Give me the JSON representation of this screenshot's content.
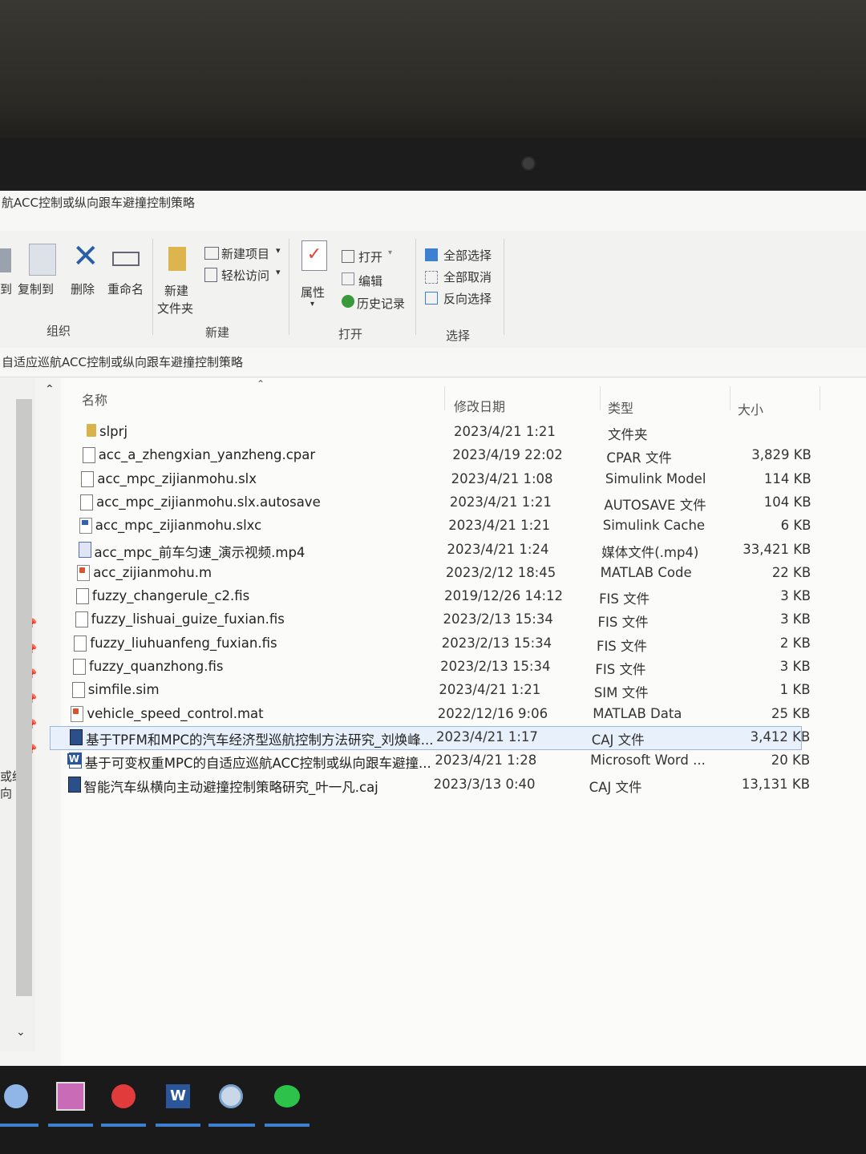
{
  "window": {
    "title": "航ACC控制或纵向跟车避撞控制策略"
  },
  "ribbon": {
    "organize": {
      "copy_to_label": "到",
      "copy_label": "复制到",
      "delete_label": "删除",
      "rename_label": "重命名",
      "group_label": "组织"
    },
    "new": {
      "new_folder_label_1": "新建",
      "new_folder_label_2": "文件夹",
      "new_item_label": "新建项目",
      "easy_access_label": "轻松访问",
      "group_label": "新建"
    },
    "open": {
      "properties_label": "属性",
      "open_label": "打开",
      "edit_label": "编辑",
      "history_label": "历史记录",
      "group_label": "打开"
    },
    "select": {
      "select_all_label": "全部选择",
      "select_none_label": "全部取消",
      "invert_label": "反向选择",
      "group_label": "选择"
    }
  },
  "address": {
    "path": "自适应巡航ACC控制或纵向跟车避撞控制策略"
  },
  "nav": {
    "partial_label": "或纵向"
  },
  "columns": {
    "name": "名称",
    "date": "修改日期",
    "type": "类型",
    "size": "大小"
  },
  "files": [
    {
      "name": "slprj",
      "date": "2023/4/21 1:21",
      "type": "文件夹",
      "size": "",
      "icon": "folder-icon"
    },
    {
      "name": "acc_a_zhengxian_yanzheng.cpar",
      "date": "2023/4/19 22:02",
      "type": "CPAR 文件",
      "size": "3,829 KB",
      "icon": "file-icon"
    },
    {
      "name": "acc_mpc_zijianmohu.slx",
      "date": "2023/4/21 1:08",
      "type": "Simulink Model",
      "size": "114 KB",
      "icon": "file-icon"
    },
    {
      "name": "acc_mpc_zijianmohu.slx.autosave",
      "date": "2023/4/21 1:21",
      "type": "AUTOSAVE 文件",
      "size": "104 KB",
      "icon": "file-icon"
    },
    {
      "name": "acc_mpc_zijianmohu.slxc",
      "date": "2023/4/21 1:21",
      "type": "Simulink Cache",
      "size": "6 KB",
      "icon": "simulink-icon"
    },
    {
      "name": "acc_mpc_前车匀速_演示视频.mp4",
      "date": "2023/4/21 1:24",
      "type": "媒体文件(.mp4)",
      "size": "33,421 KB",
      "icon": "video-icon"
    },
    {
      "name": "acc_zijianmohu.m",
      "date": "2023/2/12 18:45",
      "type": "MATLAB Code",
      "size": "22 KB",
      "icon": "matlab-icon"
    },
    {
      "name": "fuzzy_changerule_c2.fis",
      "date": "2019/12/26 14:12",
      "type": "FIS 文件",
      "size": "3 KB",
      "icon": "file-icon"
    },
    {
      "name": "fuzzy_lishuai_guize_fuxian.fis",
      "date": "2023/2/13 15:34",
      "type": "FIS 文件",
      "size": "3 KB",
      "icon": "file-icon"
    },
    {
      "name": "fuzzy_liuhuanfeng_fuxian.fis",
      "date": "2023/2/13 15:34",
      "type": "FIS 文件",
      "size": "2 KB",
      "icon": "file-icon"
    },
    {
      "name": "fuzzy_quanzhong.fis",
      "date": "2023/2/13 15:34",
      "type": "FIS 文件",
      "size": "3 KB",
      "icon": "file-icon"
    },
    {
      "name": "simfile.sim",
      "date": "2023/4/21 1:21",
      "type": "SIM 文件",
      "size": "1 KB",
      "icon": "file-icon"
    },
    {
      "name": "vehicle_speed_control.mat",
      "date": "2022/12/16 9:06",
      "type": "MATLAB Data",
      "size": "25 KB",
      "icon": "matlab-icon"
    },
    {
      "name": "基于TPFM和MPC的汽车经济型巡航控制方法研究_刘焕峰...",
      "date": "2023/4/21 1:17",
      "type": "CAJ 文件",
      "size": "3,412 KB",
      "icon": "caj-icon"
    },
    {
      "name": "基于可变权重MPC的自适应巡航ACC控制或纵向跟车避撞...",
      "date": "2023/4/21 1:28",
      "type": "Microsoft Word ...",
      "size": "20 KB",
      "icon": "word-icon"
    },
    {
      "name": "智能汽车纵横向主动避撞控制策略研究_叶一凡.caj",
      "date": "2023/3/13 0:40",
      "type": "CAJ 文件",
      "size": "13,131 KB",
      "icon": "caj-icon"
    }
  ],
  "taskbar": {
    "apps": [
      "app-icon",
      "paint-icon",
      "car-app-icon",
      "word-icon",
      "settings-icon",
      "wechat-icon"
    ]
  },
  "colors": {
    "selection": "#e8f1fb",
    "selection_border": "#9ab8dc",
    "taskbar": "#1a1a1a",
    "accent": "#3d7fd1"
  }
}
